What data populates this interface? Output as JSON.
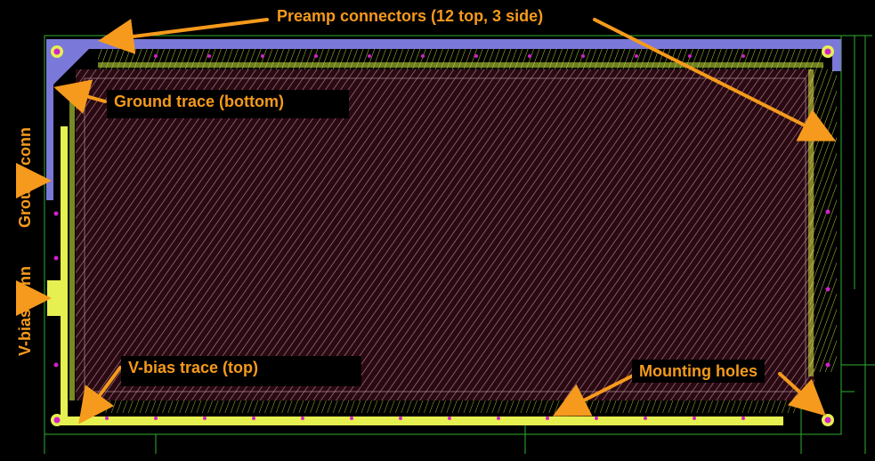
{
  "labels": {
    "preamp": "Preamp connectors (12 top, 3 side)",
    "ground_trace": "Ground trace (bottom)",
    "ground_conn": "Ground conn",
    "vbias_conn": "V-bias conn",
    "vbias_trace": "V-bias trace (top)",
    "mounting_holes": "Mounting holes"
  },
  "colors": {
    "background": "#000000",
    "board_fill": "#2a0a12",
    "hatch": "#b07c8c",
    "trace_green": "#c8e63c",
    "trace_yellow": "#e6f050",
    "ground_blue": "#7a78d8",
    "hole_magenta": "#d022c8",
    "annotation_orange": "#f59a1c",
    "outline": "#2fae2f"
  },
  "counts": {
    "top_connectors": 12,
    "side_connectors": 3
  }
}
